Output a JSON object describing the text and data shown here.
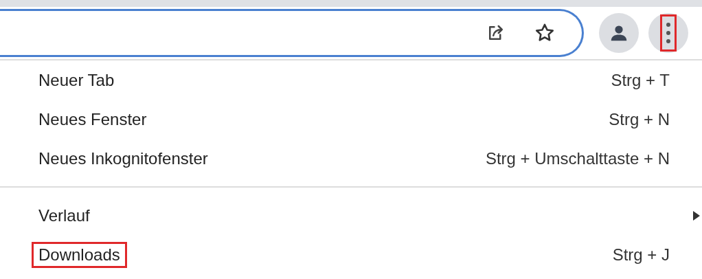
{
  "toolbar": {
    "menu_button_highlighted": true
  },
  "menu": [
    {
      "kind": "item",
      "label": "Neuer Tab",
      "shortcut": "Strg + T",
      "submenu": false,
      "highlighted": false
    },
    {
      "kind": "item",
      "label": "Neues Fenster",
      "shortcut": "Strg + N",
      "submenu": false,
      "highlighted": false
    },
    {
      "kind": "item",
      "label": "Neues Inkognitofenster",
      "shortcut": "Strg + Umschalttaste + N",
      "submenu": false,
      "highlighted": false
    },
    {
      "kind": "divider"
    },
    {
      "kind": "item",
      "label": "Verlauf",
      "submenu": true,
      "highlighted": false
    },
    {
      "kind": "item",
      "label": "Downloads",
      "shortcut": "Strg + J",
      "submenu": false,
      "highlighted": true
    }
  ]
}
